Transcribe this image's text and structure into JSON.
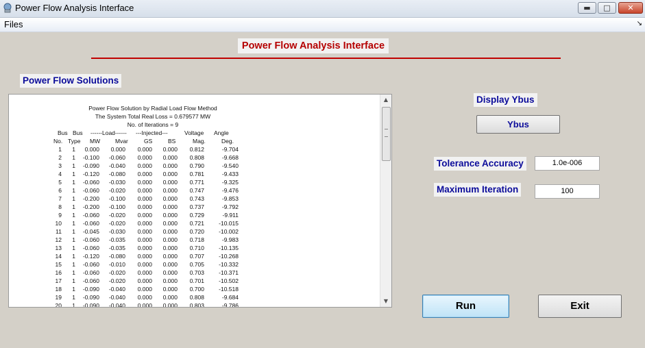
{
  "window": {
    "title": "Power Flow Analysis Interface",
    "controls": {
      "minimize": "▬",
      "maximize": "□",
      "close": "✕"
    }
  },
  "menu": {
    "files": "Files",
    "overflow_icon": "↘"
  },
  "header": {
    "title": "Power Flow Analysis Interface"
  },
  "solutions": {
    "label": "Power Flow Solutions",
    "heading_lines": [
      "Power Flow Solution by Radial Load Flow Method",
      "The System Total Real Loss = 0.679577 MW",
      "No. of Iterations = 9"
    ],
    "column_header_1": [
      "Bus",
      "Bus",
      "------Load------",
      "---Injected---",
      "Voltage",
      "Angle"
    ],
    "column_header_2": [
      "No.",
      "Type",
      "MW",
      "Mvar",
      "GS",
      "BS",
      "Mag.",
      "Deg."
    ],
    "rows": [
      [
        "1",
        "1",
        "0.000",
        "0.000",
        "0.000",
        "0.000",
        "0.812",
        "-9.704"
      ],
      [
        "2",
        "1",
        "-0.100",
        "-0.060",
        "0.000",
        "0.000",
        "0.808",
        "-9.668"
      ],
      [
        "3",
        "1",
        "-0.090",
        "-0.040",
        "0.000",
        "0.000",
        "0.790",
        "-9.540"
      ],
      [
        "4",
        "1",
        "-0.120",
        "-0.080",
        "0.000",
        "0.000",
        "0.781",
        "-9.433"
      ],
      [
        "5",
        "1",
        "-0.060",
        "-0.030",
        "0.000",
        "0.000",
        "0.771",
        "-9.325"
      ],
      [
        "6",
        "1",
        "-0.060",
        "-0.020",
        "0.000",
        "0.000",
        "0.747",
        "-9.476"
      ],
      [
        "7",
        "1",
        "-0.200",
        "-0.100",
        "0.000",
        "0.000",
        "0.743",
        "-9.853"
      ],
      [
        "8",
        "1",
        "-0.200",
        "-0.100",
        "0.000",
        "0.000",
        "0.737",
        "-9.792"
      ],
      [
        "9",
        "1",
        "-0.060",
        "-0.020",
        "0.000",
        "0.000",
        "0.729",
        "-9.911"
      ],
      [
        "10",
        "1",
        "-0.060",
        "-0.020",
        "0.000",
        "0.000",
        "0.721",
        "-10.015"
      ],
      [
        "11",
        "1",
        "-0.045",
        "-0.030",
        "0.000",
        "0.000",
        "0.720",
        "-10.002"
      ],
      [
        "12",
        "1",
        "-0.060",
        "-0.035",
        "0.000",
        "0.000",
        "0.718",
        "-9.983"
      ],
      [
        "13",
        "1",
        "-0.060",
        "-0.035",
        "0.000",
        "0.000",
        "0.710",
        "-10.135"
      ],
      [
        "14",
        "1",
        "-0.120",
        "-0.080",
        "0.000",
        "0.000",
        "0.707",
        "-10.268"
      ],
      [
        "15",
        "1",
        "-0.060",
        "-0.010",
        "0.000",
        "0.000",
        "0.705",
        "-10.332"
      ],
      [
        "16",
        "1",
        "-0.060",
        "-0.020",
        "0.000",
        "0.000",
        "0.703",
        "-10.371"
      ],
      [
        "17",
        "1",
        "-0.060",
        "-0.020",
        "0.000",
        "0.000",
        "0.701",
        "-10.502"
      ],
      [
        "18",
        "1",
        "-0.090",
        "-0.040",
        "0.000",
        "0.000",
        "0.700",
        "-10.518"
      ],
      [
        "19",
        "1",
        "-0.090",
        "-0.040",
        "0.000",
        "0.000",
        "0.808",
        "-9.684"
      ],
      [
        "20",
        "1",
        "-0.090",
        "-0.040",
        "0.000",
        "0.000",
        "0.803",
        "-9.786"
      ]
    ]
  },
  "ybus": {
    "label": "Display Ybus",
    "button": "Ybus"
  },
  "tolerance": {
    "label": "Tolerance Accuracy",
    "value": "1.0e-006"
  },
  "max_iteration": {
    "label": "Maximum Iteration",
    "value": "100"
  },
  "actions": {
    "run": "Run",
    "exit": "Exit"
  },
  "colors": {
    "title_red": "#b50000",
    "label_blue": "#0b0b9a",
    "rule_red": "#c00000",
    "background": "#d4d0c8"
  }
}
